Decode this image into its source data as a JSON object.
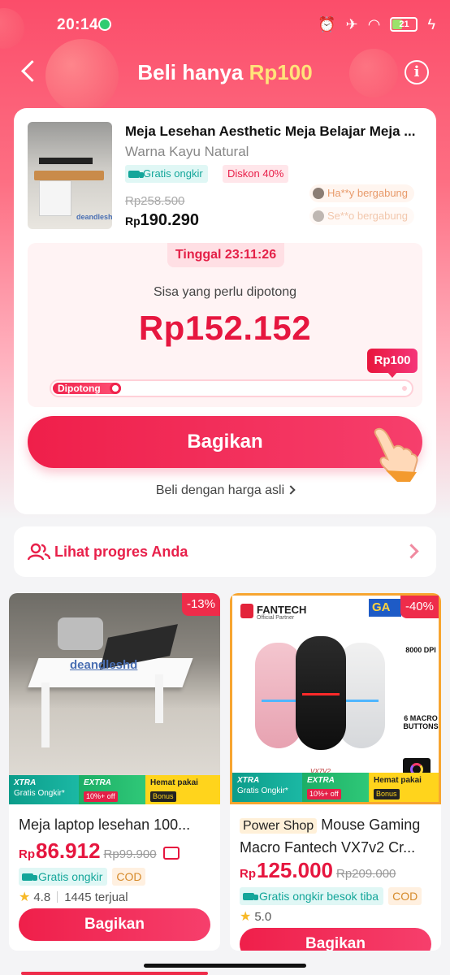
{
  "status_bar": {
    "time": "20:14",
    "battery": "21"
  },
  "header": {
    "title_prefix": "Beli hanya",
    "title_price": "Rp100"
  },
  "product": {
    "title": "Meja Lesehan Aesthetic Meja Belajar Meja ...",
    "variant": "Warna  Kayu Natural",
    "tag_free": "Gratis ongkir",
    "tag_discount": "Diskon 40%",
    "original_price": "Rp258.500",
    "price_currency": "Rp",
    "price_value": "190.290",
    "thumb_watermark": "deandleshd",
    "joined": [
      "Ha**y bergabung",
      "Se**o bergabung"
    ]
  },
  "cut": {
    "timer": "Tinggal 23:11:26",
    "remaining_label": "Sisa yang perlu dipotong",
    "remaining_value": "Rp152.152",
    "target_badge": "Rp100",
    "progress_label": "Dipotong",
    "progress_fraction": 0.18
  },
  "actions": {
    "share": "Bagikan",
    "buy_original": "Beli dengan harga asli"
  },
  "progress_link": {
    "label": "Lihat progres Anda"
  },
  "products": [
    {
      "discount": "-13%",
      "watermark": "deandleshd",
      "name": "Meja laptop lesehan 100...",
      "price_currency": "Rp",
      "price": "86.912",
      "original_price": "Rp99.900",
      "tag_free": "Gratis ongkir",
      "tag_cod": "COD",
      "rating": "4.8",
      "sold": "1445 terjual",
      "share": "Bagikan",
      "promo": {
        "xtra_title": "XTRA",
        "xtra_sub": "Gratis Ongkir*",
        "extra_title": "EXTRA",
        "extra_sub": "10%+ off",
        "hemat_title": "Hemat pakai",
        "hemat_sub": "Bonus"
      }
    },
    {
      "discount": "-40%",
      "brand": "FANTECH",
      "brand_sub": "Official Partner",
      "ribbon": "GA",
      "spec_dpi": "8000 DPI",
      "spec_buttons": "6 MACRO BUTTONS",
      "model": "VX7V2",
      "shop_tag": "Power Shop",
      "name": "Mouse Gaming Macro Fantech VX7v2 Cr...",
      "price_currency": "Rp",
      "price": "125.000",
      "original_price": "Rp209.000",
      "tag_free": "Gratis ongkir besok tiba",
      "tag_cod": "COD",
      "rating": "5.0",
      "share": "Bagikan",
      "promo": {
        "xtra_title": "XTRA",
        "xtra_sub": "Gratis Ongkir*",
        "extra_title": "EXTRA",
        "extra_sub": "10%+ off",
        "hemat_title": "Hemat pakai",
        "hemat_sub": "Bonus"
      }
    }
  ],
  "colors": {
    "accent": "#ee2c4a",
    "highlight": "#ffe27a",
    "teal": "#14a69a"
  }
}
